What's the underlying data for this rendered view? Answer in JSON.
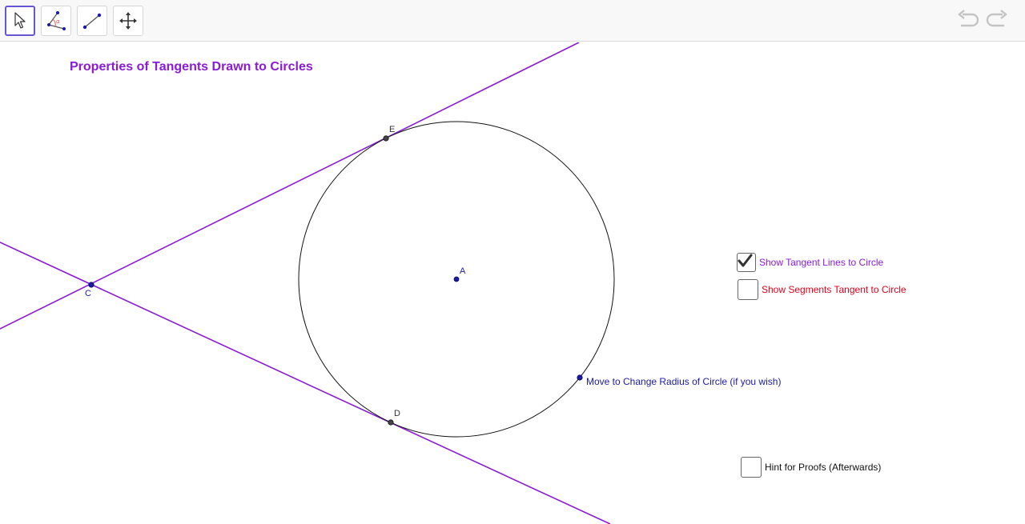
{
  "toolbar": {
    "tools": [
      {
        "name": "move-tool",
        "icon": "cursor-arrow-icon",
        "selected": true
      },
      {
        "name": "angle-tool",
        "icon": "angle-icon",
        "selected": false
      },
      {
        "name": "segment-tool",
        "icon": "segment-icon",
        "selected": false
      },
      {
        "name": "move-graphics-view-tool",
        "icon": "move-arrows-icon",
        "selected": false
      }
    ],
    "undo_icon": "undo-icon",
    "redo_icon": "redo-icon"
  },
  "worksheet": {
    "title": "Properties of Tangents Drawn to Circles",
    "points": {
      "A": "A",
      "C": "C",
      "D": "D",
      "E": "E"
    },
    "radius_handle_label": "Move to Change Radius of Circle (if you wish)",
    "checkboxes": [
      {
        "label": "Show Tangent Lines to Circle",
        "checked": true,
        "color": "#8a1bd6"
      },
      {
        "label": "Show Segments Tangent to Circle",
        "checked": false,
        "color": "#e0001a"
      },
      {
        "label": "Hint for Proofs (Afterwards)",
        "checked": false,
        "color": "#111111"
      }
    ]
  },
  "colors": {
    "accent": "#6557d2",
    "tangent_line": "#8a1bd6",
    "point_blue": "#1a1aa6",
    "point_dark": "#444444"
  }
}
